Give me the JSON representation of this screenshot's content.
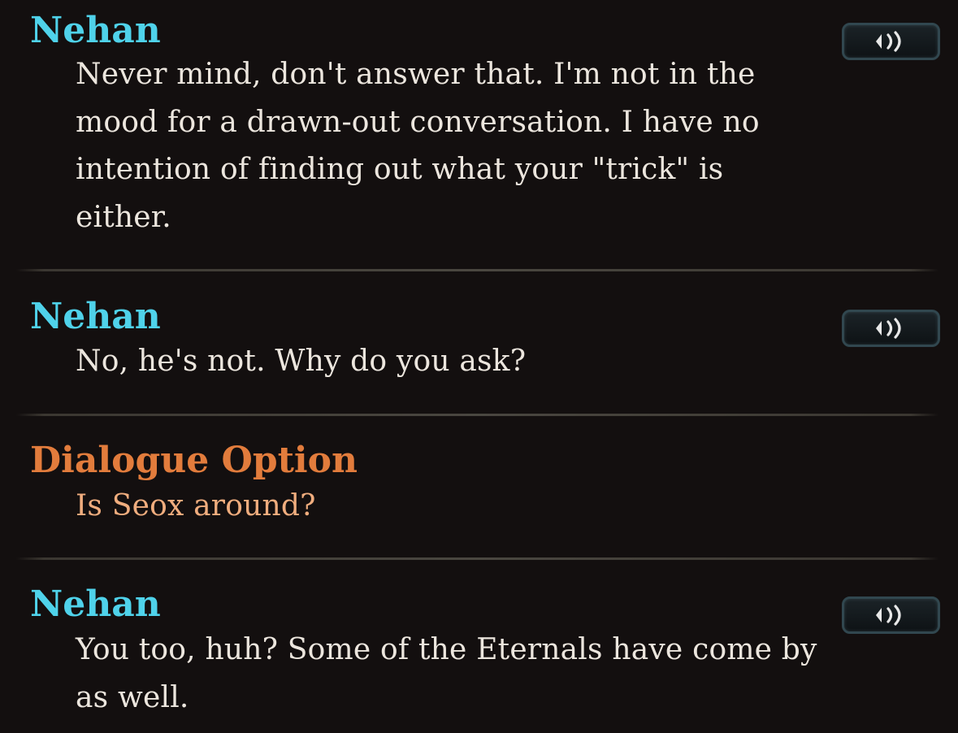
{
  "entries": [
    {
      "speaker": "Nehan",
      "type": "npc",
      "text": "Never mind, don't answer that. I'm not in the mood for a drawn-out conversation. I have no intention of finding out what your \"trick\" is either.",
      "has_voice": true
    },
    {
      "speaker": "Nehan",
      "type": "npc",
      "text": "No, he's not. Why do you ask?",
      "has_voice": true
    },
    {
      "speaker": "Dialogue Option",
      "type": "option",
      "text": "Is Seox around?",
      "has_voice": false
    },
    {
      "speaker": "Nehan",
      "type": "npc",
      "text": "You too, huh? Some of the Eternals have come by as well.",
      "has_voice": true
    }
  ],
  "icons": {
    "voice_button": "speaker-volume-icon"
  },
  "colors": {
    "background": "#130f0f",
    "npc_name": "#4fd2ea",
    "option_name": "#e27c3c",
    "npc_text": "#ece6de",
    "option_text": "#f0ad7e",
    "voice_button_border": "#31474f"
  }
}
